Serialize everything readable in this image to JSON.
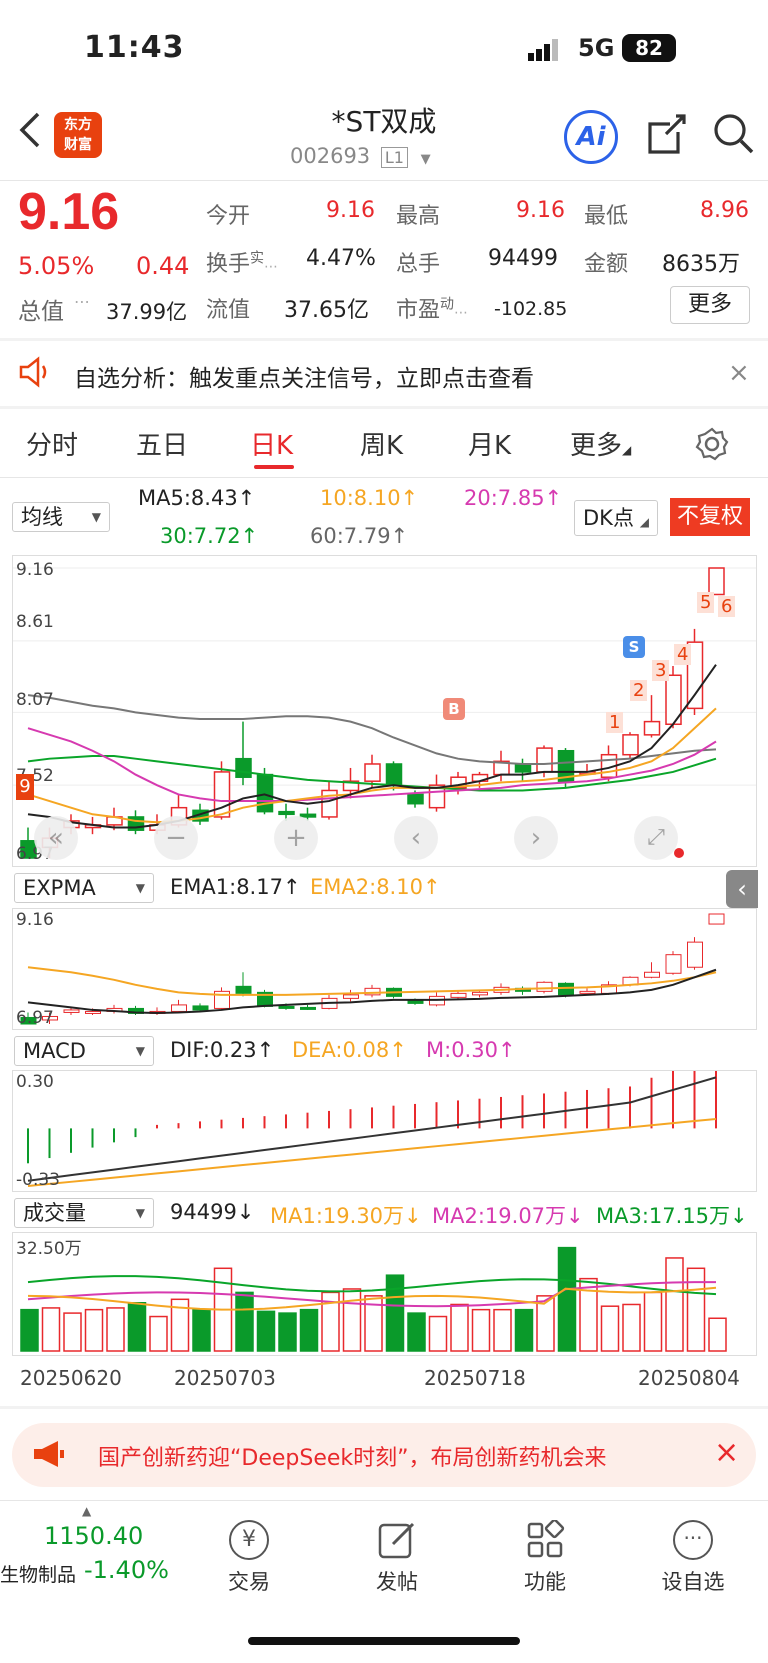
{
  "status": {
    "time": "11:43",
    "network": "5G",
    "battery": "82"
  },
  "header": {
    "logo_line1": "东方",
    "logo_line2": "财富",
    "title": "*ST双成",
    "code": "002693",
    "level": "L1"
  },
  "quote": {
    "price": "9.16",
    "change_pct": "5.05%",
    "change": "0.44",
    "open_label": "今开",
    "open": "9.16",
    "high_label": "最高",
    "high": "9.16",
    "low_label": "最低",
    "low": "8.96",
    "turnover_label": "换手",
    "turnover_sup": "实",
    "turnover": "4.47%",
    "volume_label": "总手",
    "volume": "94499",
    "amount_label": "金额",
    "amount": "8635万",
    "mktcap_label": "总值",
    "mktcap": "37.99亿",
    "float_label": "流值",
    "float": "37.65亿",
    "pe_label": "市盈",
    "pe_sup": "动",
    "pe": "-102.85",
    "more": "更多"
  },
  "notice": {
    "text": "自选分析：触发重点关注信号，立即点击查看"
  },
  "tabs": [
    "分时",
    "五日",
    "日K",
    "周K",
    "月K",
    "更多"
  ],
  "kline": {
    "ind_select": "均线",
    "ma5": "MA5:8.43↑",
    "ma10": "10:8.10↑",
    "ma20": "20:7.85↑",
    "ma30": "30:7.72↑",
    "ma60": "60:7.79↑",
    "dk": "DK点",
    "unadjusted": "不复权",
    "y_top": "9.16",
    "y_2": "8.61",
    "y_3": "8.07",
    "y_4": "7.52",
    "y_bottom": "6.97",
    "left_tag": "9",
    "signal_b": "B",
    "signal_s": "S",
    "counts": [
      "1",
      "2",
      "3",
      "4",
      "5",
      "6"
    ]
  },
  "expma": {
    "select": "EXPMA",
    "ema1": "EMA1:8.17↑",
    "ema2": "EMA2:8.10↑",
    "y_top": "9.16",
    "y_bottom": "6.97"
  },
  "macd": {
    "select": "MACD",
    "dif": "DIF:0.23↑",
    "dea": "DEA:0.08↑",
    "m": "M:0.30↑",
    "y_top": "0.30",
    "y_bottom": "-0.33"
  },
  "vol": {
    "select": "成交量",
    "value": "94499↓",
    "ma1": "MA1:19.30万↓",
    "ma2": "MA2:19.07万↓",
    "ma3": "MA3:17.15万↓",
    "y_top": "32.50万"
  },
  "dates": [
    "20250620",
    "20250703",
    "20250718",
    "20250804"
  ],
  "banner": {
    "text": "国产创新药迎“DeepSeek时刻”，布局创新药机会来"
  },
  "bottom": {
    "index_value": "1150.40",
    "index_name": "生物制品",
    "index_change": "-1.40%",
    "trade": "交易",
    "post": "发帖",
    "functions": "功能",
    "watch": "设自选"
  },
  "colors": {
    "up": "#e8292c",
    "down": "#0a9a2a",
    "ma5": "#222222",
    "ma10": "#f5a623",
    "ma20": "#d63ab0",
    "ma30": "#0aa52a",
    "ma60": "#777777"
  }
}
